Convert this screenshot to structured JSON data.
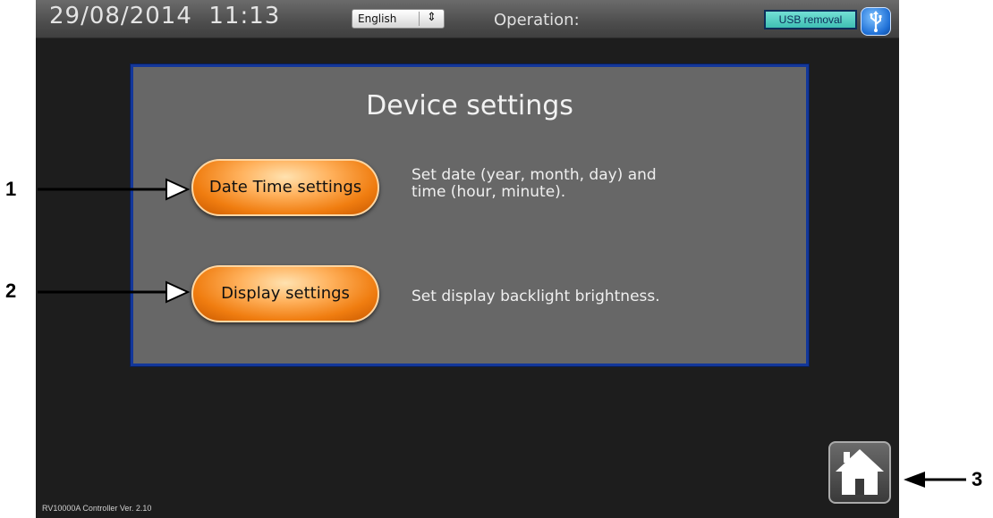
{
  "header": {
    "datetime": "29/08/2014  11:13",
    "language_selected": "English",
    "operation_label": "Operation:",
    "usb_removal_label": "USB removal",
    "usb_icon": "usb-icon"
  },
  "panel": {
    "title": "Device settings",
    "items": [
      {
        "button_label": "Date Time settings",
        "desc_line1": "Set date (year, month, day) and",
        "desc_line2": "time (hour, minute)."
      },
      {
        "button_label": "Display settings",
        "desc_line1": "Set display backlight brightness.",
        "desc_line2": ""
      }
    ]
  },
  "footer": {
    "version": "RV10000A Controller Ver. 2.10",
    "home_icon": "home-icon"
  },
  "callouts": [
    "1",
    "2",
    "3"
  ],
  "colors": {
    "panel_border": "#13379a",
    "button_orange": "#f07d10",
    "usb_button": "#3fbfb3",
    "background": "#1d1d1d"
  }
}
